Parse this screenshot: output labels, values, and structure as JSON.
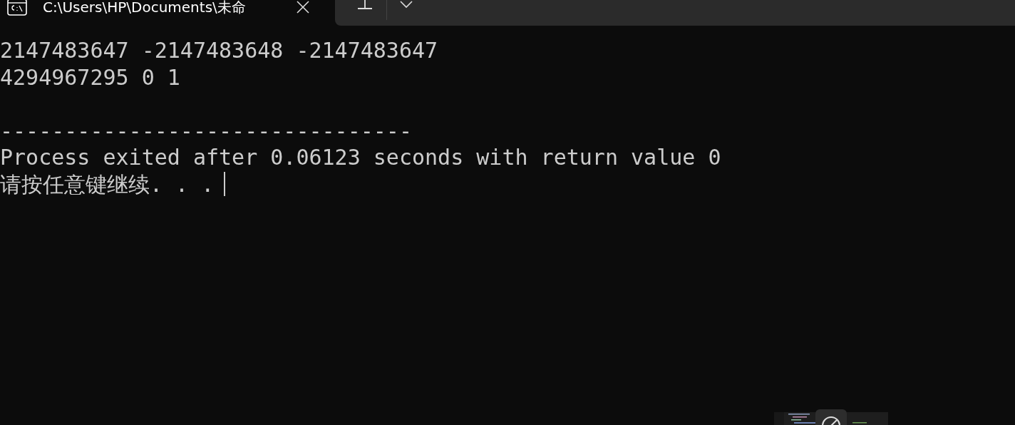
{
  "tabs": [
    {
      "title": "C:\\Users\\HP\\Documents\\未命",
      "selected": true
    }
  ],
  "console": {
    "output_lines": [
      "2147483647 -2147483648 -2147483647",
      "4294967295 0 1"
    ],
    "lines": [
      "--------------------------------",
      "Process exited after 0.06123 seconds with return value 0",
      "请按任意键继续. . ."
    ],
    "cursor": true
  }
}
